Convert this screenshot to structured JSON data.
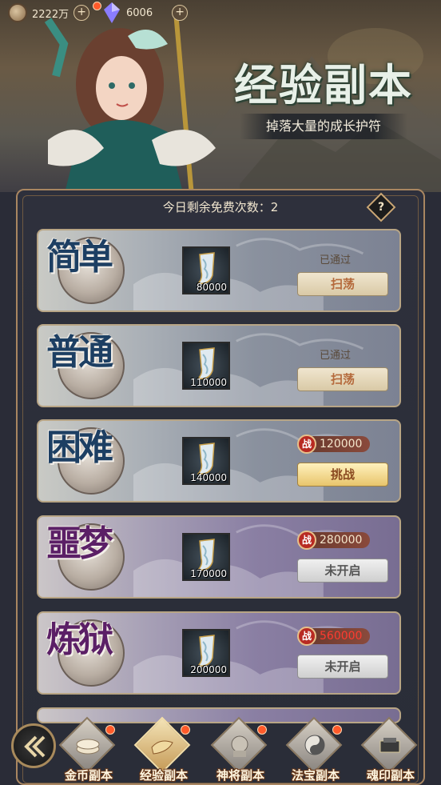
{
  "resources": {
    "coins": "2222万",
    "gems": "6006"
  },
  "header": {
    "title": "经验副本",
    "subtitle": "掉落大量的成长护符"
  },
  "free_count_label": "今日剩余免费次数：2",
  "help_label": "?",
  "levels": [
    {
      "name": "简单",
      "reward_count": "80000",
      "status": "已通过",
      "button": "扫荡",
      "button_type": "sweep",
      "theme": "blue"
    },
    {
      "name": "普通",
      "reward_count": "110000",
      "status": "已通过",
      "button": "扫荡",
      "button_type": "sweep",
      "theme": "blue"
    },
    {
      "name": "困难",
      "reward_count": "140000",
      "power_badge": "战",
      "power": "120000",
      "power_insufficient": false,
      "button": "挑战",
      "button_type": "challenge",
      "theme": "blue"
    },
    {
      "name": "噩梦",
      "reward_count": "170000",
      "power_badge": "战",
      "power": "280000",
      "power_insufficient": false,
      "button": "未开启",
      "button_type": "locked",
      "theme": "purple"
    },
    {
      "name": "炼狱",
      "reward_count": "200000",
      "power_badge": "战",
      "power": "560000",
      "power_insufficient": true,
      "button": "未开启",
      "button_type": "locked",
      "theme": "purple"
    }
  ],
  "tabs": [
    {
      "label": "金币副本",
      "active": false,
      "icon": "coins-icon"
    },
    {
      "label": "经验副本",
      "active": true,
      "icon": "scroll-icon"
    },
    {
      "label": "神将副本",
      "active": false,
      "icon": "general-head-icon"
    },
    {
      "label": "法宝副本",
      "active": false,
      "icon": "yin-yang-icon"
    },
    {
      "label": "魂印副本",
      "active": false,
      "icon": "soul-seal-icon"
    }
  ],
  "colors": {
    "accent_gold": "#caa675",
    "notification": "#ff5a2a",
    "insufficient_power": "#ff3b30"
  }
}
